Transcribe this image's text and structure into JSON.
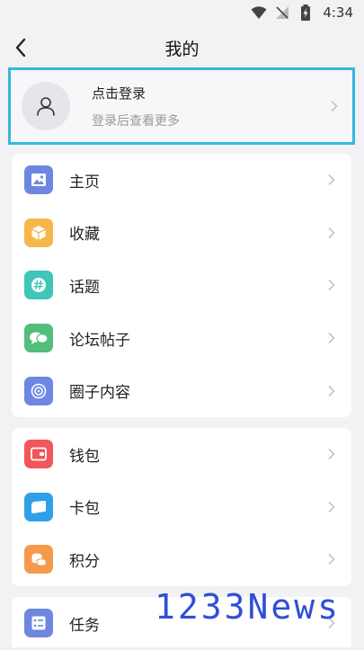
{
  "status_bar": {
    "time": "4:34"
  },
  "header": {
    "title": "我的"
  },
  "login": {
    "title": "点击登录",
    "subtitle": "登录后查看更多"
  },
  "groups": [
    {
      "items": [
        {
          "label": "主页",
          "icon": "image-icon",
          "color": "#6d87e0"
        },
        {
          "label": "收藏",
          "icon": "box-icon",
          "color": "#f6b74a"
        },
        {
          "label": "话题",
          "icon": "hashtag-icon",
          "color": "#3fc6b8"
        },
        {
          "label": "论坛帖子",
          "icon": "chat-bubbles-icon",
          "color": "#53bd7c"
        },
        {
          "label": "圈子内容",
          "icon": "circle-content-icon",
          "color": "#6e86e4"
        }
      ]
    },
    {
      "items": [
        {
          "label": "钱包",
          "icon": "wallet-icon",
          "color": "#f0565a"
        },
        {
          "label": "卡包",
          "icon": "card-holder-icon",
          "color": "#2f9fe8"
        },
        {
          "label": "积分",
          "icon": "coins-icon",
          "color": "#f59a4a"
        }
      ]
    },
    {
      "items": [
        {
          "label": "任务",
          "icon": "task-list-icon",
          "color": "#6d87e0"
        }
      ]
    }
  ],
  "watermark": {
    "text": "1233News"
  }
}
